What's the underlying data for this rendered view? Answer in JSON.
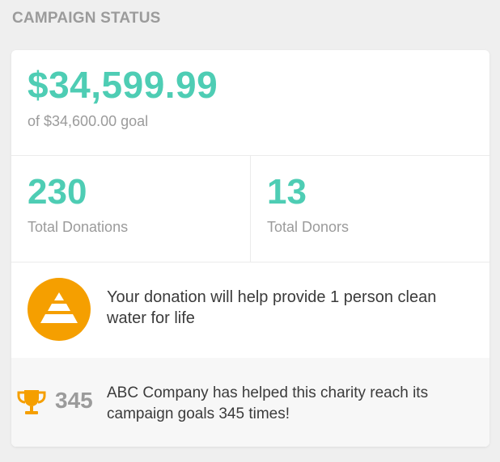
{
  "section_title": "CAMPAIGN STATUS",
  "raised": {
    "amount": "$34,599.99",
    "goal_text": "of $34,600.00 goal"
  },
  "stats": {
    "donations": {
      "value": "230",
      "label": "Total Donations"
    },
    "donors": {
      "value": "13",
      "label": "Total Donors"
    }
  },
  "impact": {
    "icon": "water-drop-pyramid-icon",
    "text": "Your donation will help provide 1 person clean water for life"
  },
  "company": {
    "icon": "trophy-icon",
    "count": "345",
    "text": "ABC Company has helped this charity reach its campaign goals 345 times!"
  },
  "colors": {
    "accent": "#4ecdb4",
    "orange": "#f59f00",
    "muted": "#9b9b9b",
    "text": "#3b3b3b",
    "background": "#efefef"
  }
}
